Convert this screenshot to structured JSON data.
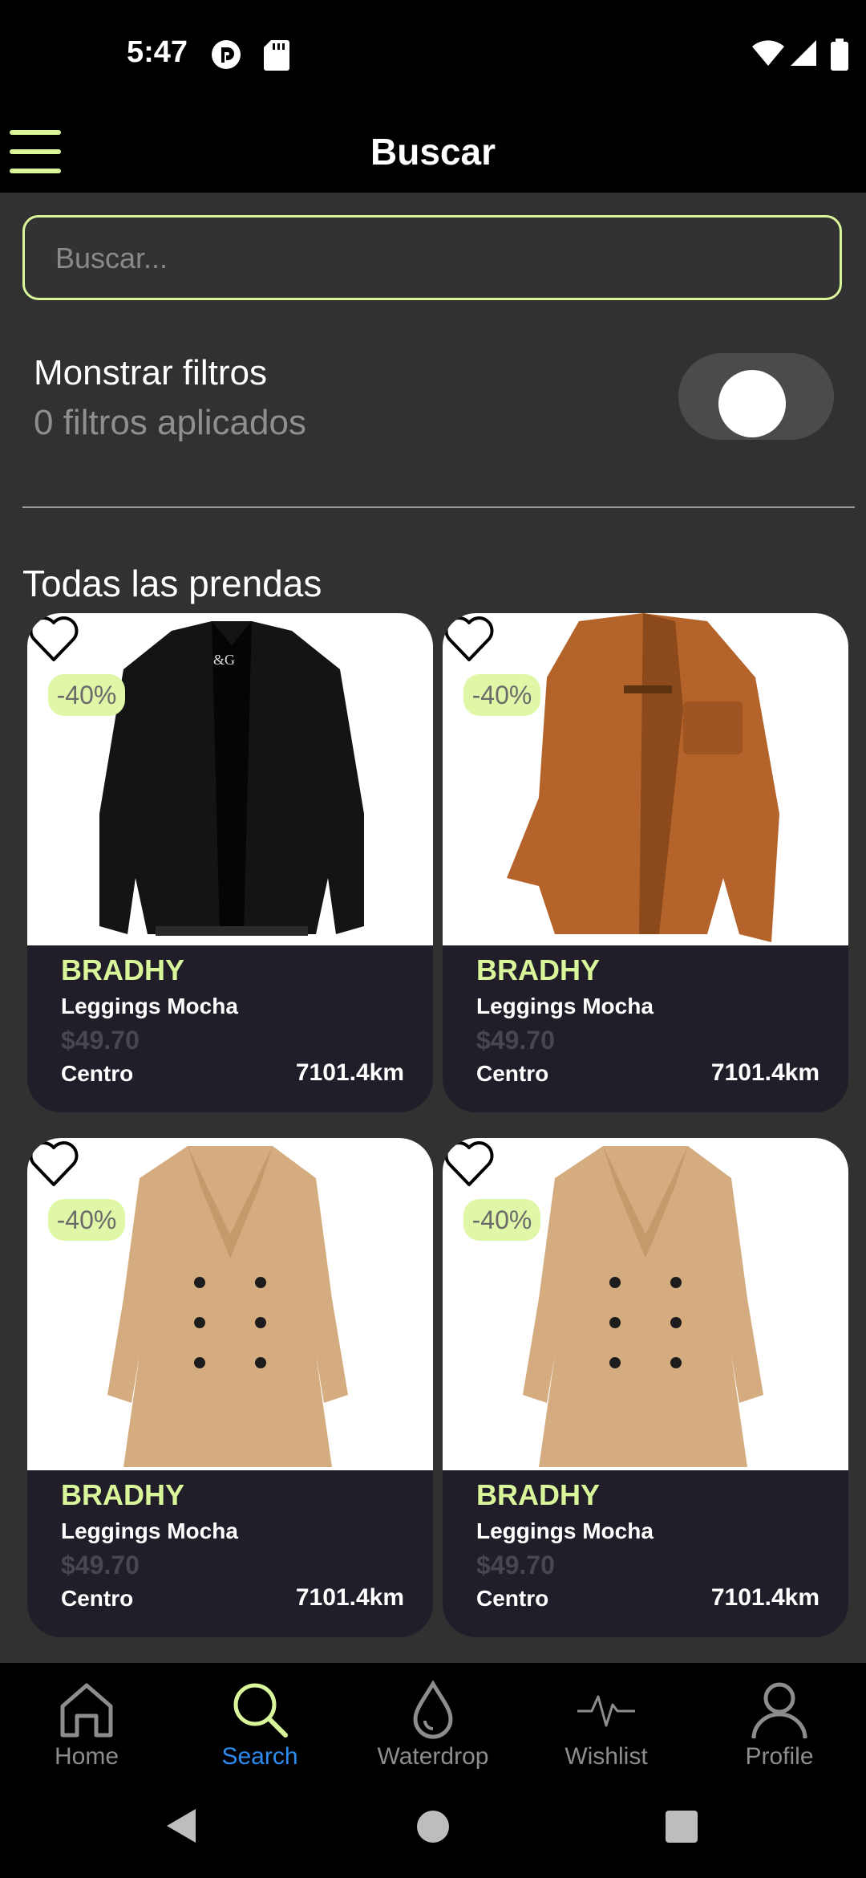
{
  "status": {
    "time": "5:47"
  },
  "header": {
    "title": "Buscar"
  },
  "search": {
    "placeholder": "Buscar..."
  },
  "filters": {
    "title": "Monstrar filtros",
    "subtitle": "0 filtros aplicados",
    "enabled": false
  },
  "section": {
    "title": "Todas las prendas"
  },
  "products": [
    {
      "discount": "-40%",
      "brand": "BRADHY",
      "name": "Leggings Mocha",
      "price": "$49.70",
      "location": "Centro",
      "distance": "7101.4km",
      "image": "black-leather-jacket"
    },
    {
      "discount": "-40%",
      "brand": "BRADHY",
      "name": "Leggings Mocha",
      "price": "$49.70",
      "location": "Centro",
      "distance": "7101.4km",
      "image": "brown-leather-jacket"
    },
    {
      "discount": "-40%",
      "brand": "BRADHY",
      "name": "Leggings Mocha",
      "price": "$49.70",
      "location": "Centro",
      "distance": "7101.4km",
      "image": "camel-trench-coat"
    },
    {
      "discount": "-40%",
      "brand": "BRADHY",
      "name": "Leggings Mocha",
      "price": "$49.70",
      "location": "Centro",
      "distance": "7101.4km",
      "image": "camel-trench-coat"
    }
  ],
  "nav": {
    "items": [
      {
        "label": "Home",
        "icon": "home-icon"
      },
      {
        "label": "Search",
        "icon": "search-icon",
        "active": true
      },
      {
        "label": "Waterdrop",
        "icon": "waterdrop-icon"
      },
      {
        "label": "Wishlist",
        "icon": "pulse-icon"
      },
      {
        "label": "Profile",
        "icon": "person-icon"
      }
    ]
  },
  "colors": {
    "accent": "#d9f79a",
    "active_nav": "#2d8cf0",
    "card_bg": "#211e2a",
    "page_bg": "#313131"
  }
}
